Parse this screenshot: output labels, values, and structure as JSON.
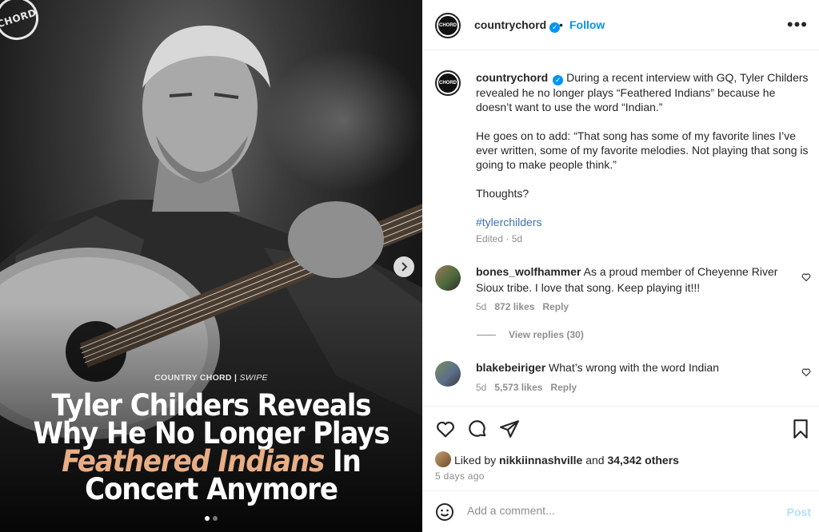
{
  "media": {
    "logo_text": "CHORD",
    "swipe_label_brand": "COUNTRY CHORD | ",
    "swipe_label_action": "SWIPE",
    "headline_line1": "Tyler Childers Reveals",
    "headline_line2": "Why He No Longer Plays",
    "headline_accent": "Feathered Indians",
    "headline_line3_rest": " In",
    "headline_line4": "Concert Anymore",
    "accent_color": "#e8ae86",
    "carousel_dots": 2,
    "carousel_active": 1,
    "next_icon": "chevron-right-icon"
  },
  "header": {
    "username": "countrychord",
    "bullet": "•",
    "follow_label": "Follow",
    "more_icon": "more-options-icon"
  },
  "caption": {
    "username": "countrychord",
    "text_p1": "During a recent interview with GQ, Tyler Childers revealed he no longer plays “Feathered Indians” because he doesn’t want to use the word “Indian.”",
    "text_p2": "He goes on to add: “That song has some of my favorite lines I’ve ever written, some of my favorite melodies. Not playing that song is going to make people think.”",
    "text_p3": "Thoughts?",
    "hashtag": "#tylerchilders",
    "edited": "Edited · 5d"
  },
  "comments": [
    {
      "username": "bones_wolfhammer",
      "text": "As a proud member of Cheyenne River Sioux tribe. I love that song. Keep playing it!!!",
      "age": "5d",
      "likes": "872 likes",
      "reply": "Reply"
    },
    {
      "username": "blakebeiriger",
      "text": "What’s wrong with the word Indian",
      "age": "5d",
      "likes": "5,573 likes",
      "reply": "Reply"
    }
  ],
  "view_replies": "View replies (30)",
  "actions": {
    "liked_by_prefix": "Liked by ",
    "liked_by_user": "nikkiinnashville",
    "liked_by_and": " and ",
    "liked_by_count": "34,342 others",
    "time_ago": "5 days ago"
  },
  "comment_box": {
    "placeholder": "Add a comment...",
    "post_label": "Post"
  },
  "colors": {
    "link_blue": "#0095f6",
    "hashtag": "#3e6fb5",
    "muted": "#8e8e8e"
  }
}
